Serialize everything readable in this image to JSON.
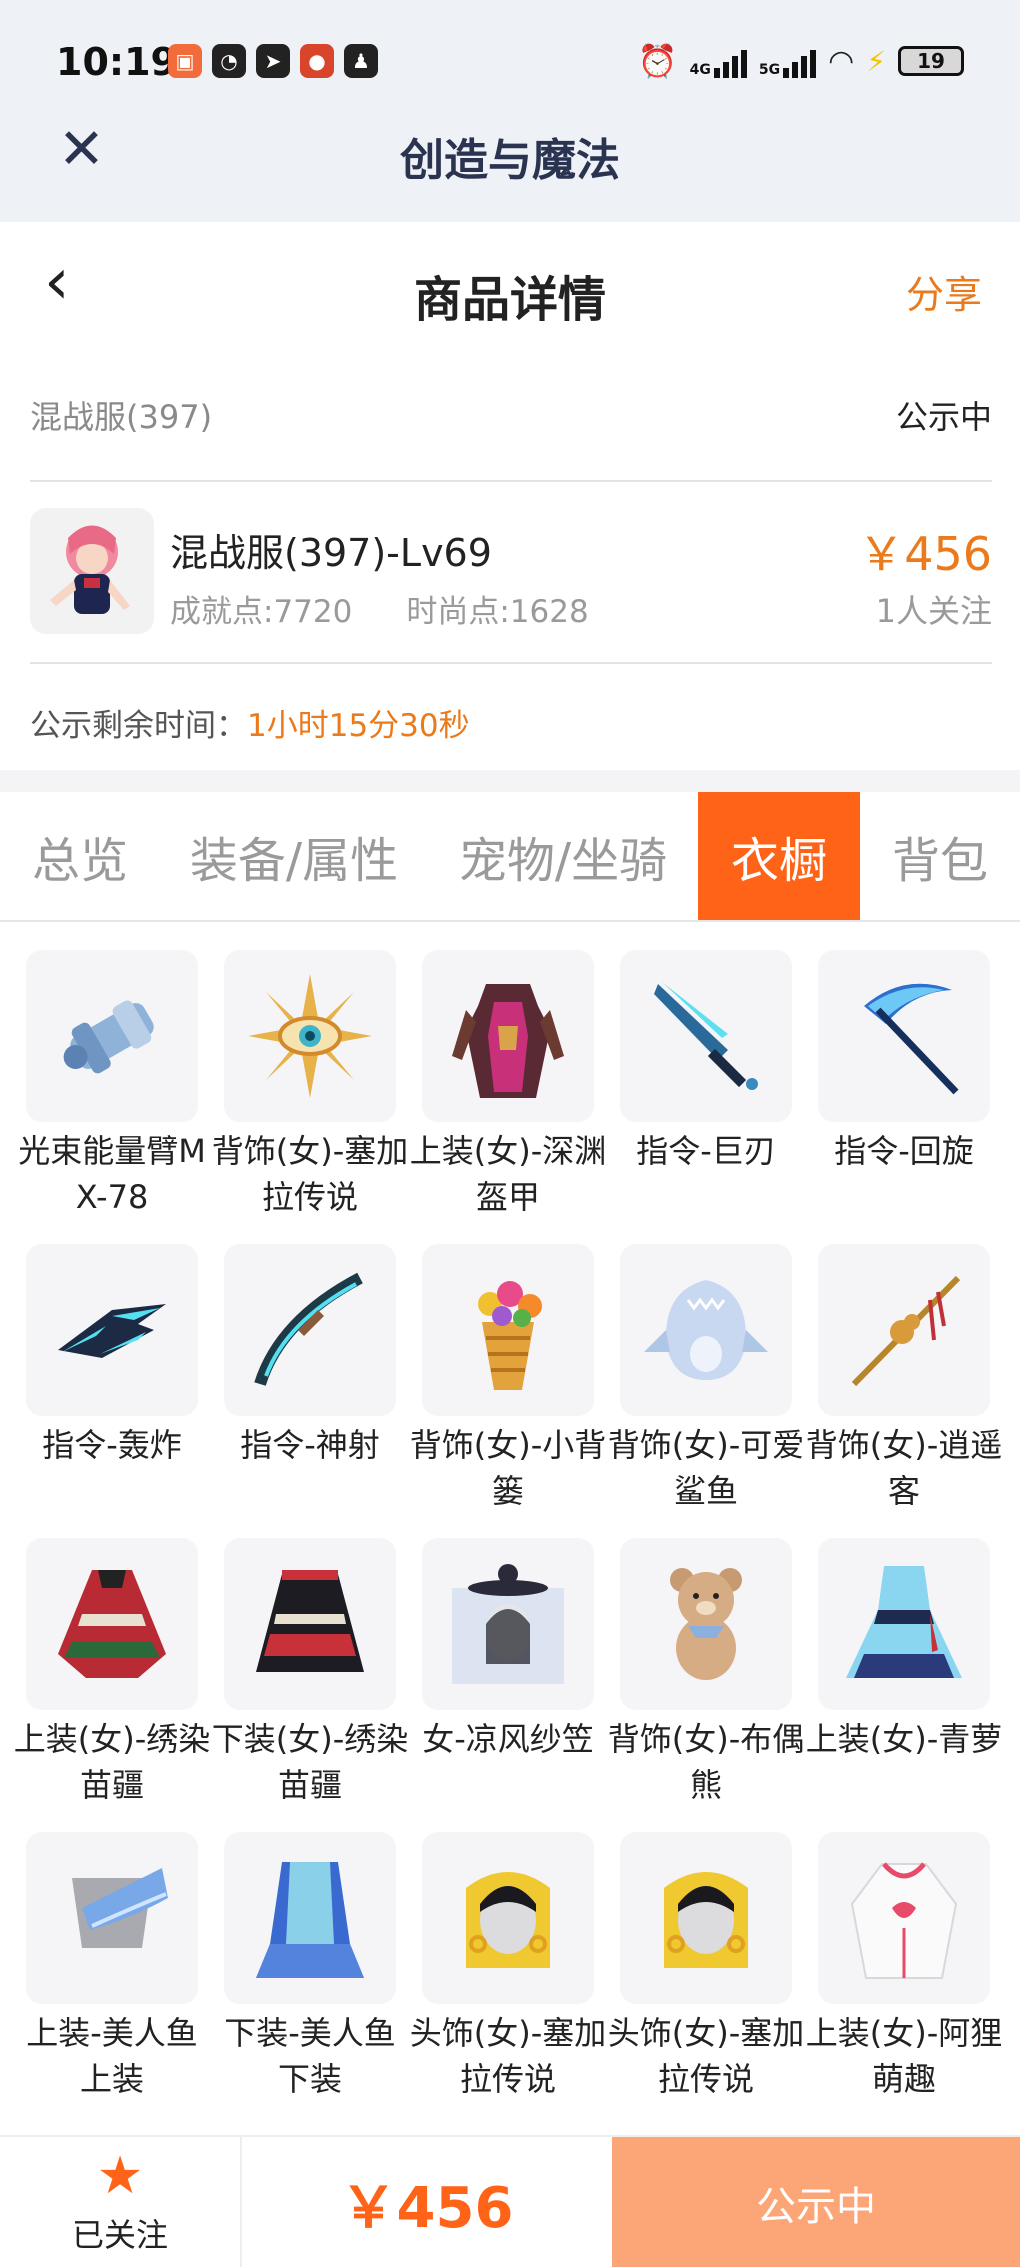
{
  "status_bar": {
    "time": "10:19",
    "battery": "19",
    "signal_labels": [
      "4G",
      "5G"
    ]
  },
  "app_bar": {
    "title": "创造与魔法"
  },
  "page": {
    "title": "商品详情",
    "share_label": "分享"
  },
  "product": {
    "server": "混战服(397)",
    "status": "公示中",
    "name": "混战服(397)-Lv69",
    "achievement": "成就点:7720",
    "fashion": "时尚点:1628",
    "price": "￥456",
    "followers": "1人关注",
    "timer_label": "公示剩余时间：",
    "timer_value": "1小时15分30秒"
  },
  "tabs": [
    {
      "label": "总览",
      "active": false
    },
    {
      "label": "装备/属性",
      "active": false
    },
    {
      "label": "宠物/坐骑",
      "active": false
    },
    {
      "label": "衣橱",
      "active": true
    },
    {
      "label": "背包",
      "active": false
    }
  ],
  "wardrobe": [
    {
      "label": "光束能量臂MX-78",
      "icon": "arm-cannon-icon"
    },
    {
      "label": "背饰(女)-塞加拉传说",
      "icon": "eye-emblem-icon"
    },
    {
      "label": "上装(女)-深渊盔甲",
      "icon": "armor-icon"
    },
    {
      "label": "指令-巨刃",
      "icon": "blade-icon"
    },
    {
      "label": "指令-回旋",
      "icon": "scythe-icon"
    },
    {
      "label": "指令-轰炸",
      "icon": "bomber-icon"
    },
    {
      "label": "指令-神射",
      "icon": "bow-icon"
    },
    {
      "label": "背饰(女)-小背篓",
      "icon": "flower-basket-icon"
    },
    {
      "label": "背饰(女)-可爱鲨鱼",
      "icon": "shark-icon"
    },
    {
      "label": "背饰(女)-逍遥客",
      "icon": "gourd-staff-icon"
    },
    {
      "label": "上装(女)-绣染苗疆",
      "icon": "embroidered-top-icon"
    },
    {
      "label": "下装(女)-绣染苗疆",
      "icon": "embroidered-skirt-icon"
    },
    {
      "label": "女-凉风纱笠",
      "icon": "veil-hat-icon"
    },
    {
      "label": "背饰(女)-布偶熊",
      "icon": "teddy-bear-icon"
    },
    {
      "label": "上装(女)-青萝",
      "icon": "dress-icon"
    },
    {
      "label": "上装-美人鱼上装",
      "icon": "mermaid-top-icon"
    },
    {
      "label": "下装-美人鱼下装",
      "icon": "mermaid-tail-icon"
    },
    {
      "label": "头饰(女)-塞加拉传说",
      "icon": "headdress-icon"
    },
    {
      "label": "头饰(女)-塞加拉传说",
      "icon": "headdress-icon"
    },
    {
      "label": "上装(女)-阿狸萌趣",
      "icon": "hoodie-icon"
    }
  ],
  "bottom_bar": {
    "follow_label": "已关注",
    "price": "￥456",
    "action_label": "公示中"
  },
  "colors": {
    "accent": "#ff6318",
    "price": "#ea7a1c",
    "action_disabled": "#fca678",
    "app_bar_bg": "#eef2f7"
  }
}
